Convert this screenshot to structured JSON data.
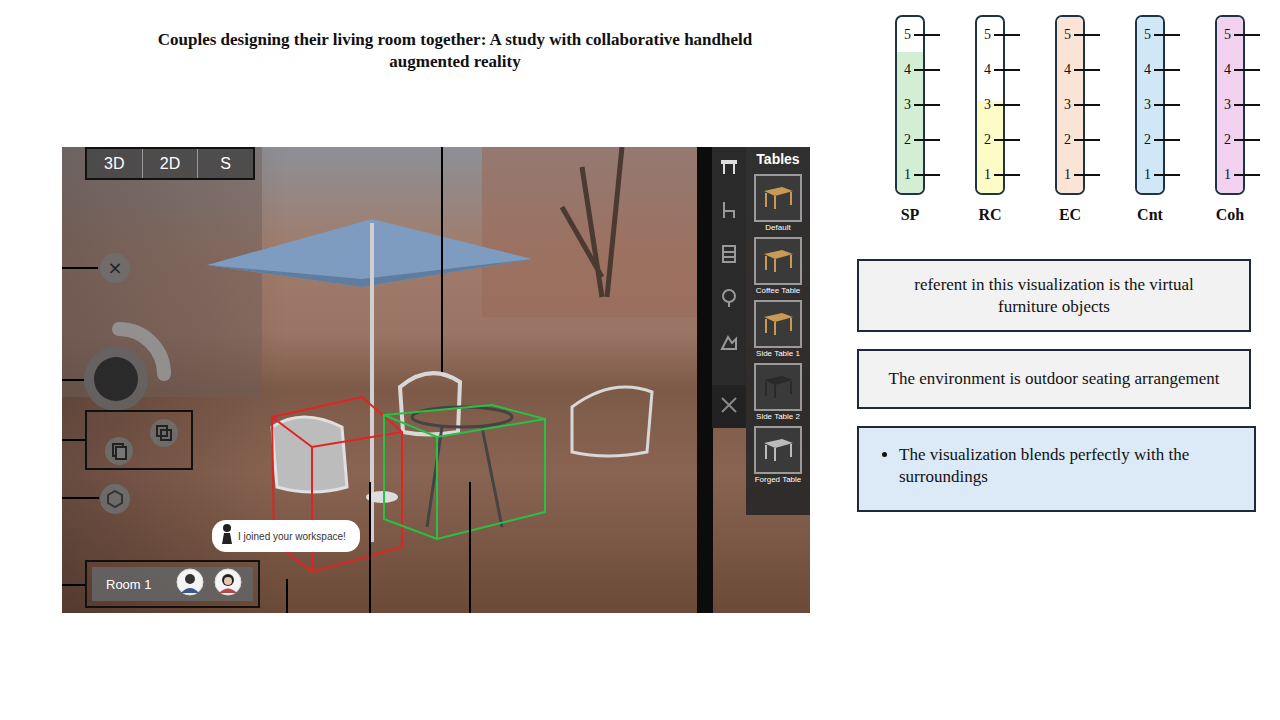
{
  "title": "Couples designing their living room together: A study with collaborative handheld augmented reality",
  "ar_app": {
    "view_modes": [
      {
        "label": "3D"
      },
      {
        "label": "2D"
      },
      {
        "label": "S"
      }
    ],
    "close_icon": "×",
    "catalog": {
      "title": "Tables",
      "items": [
        {
          "label": "Default"
        },
        {
          "label": "Coffee Table"
        },
        {
          "label": "Side Table 1"
        },
        {
          "label": "Side Table 2"
        },
        {
          "label": "Forged Table"
        }
      ]
    },
    "notification": "I joined your workspace!",
    "room": {
      "label": "Room 1"
    },
    "bounding_boxes": [
      {
        "color": "#e02424"
      },
      {
        "color": "#25c244"
      }
    ]
  },
  "scales": [
    {
      "label": "SP",
      "level": 0.8,
      "color": "#d3eed3",
      "ticks": [
        "5",
        "4",
        "3",
        "2",
        "1"
      ]
    },
    {
      "label": "RC",
      "level": 0.52,
      "color": "#fdfcc6",
      "ticks": [
        "5",
        "4",
        "3",
        "2",
        "1"
      ]
    },
    {
      "label": "EC",
      "level": 1,
      "color": "#fbe4d6",
      "ticks": [
        "5",
        "4",
        "3",
        "2",
        "1"
      ]
    },
    {
      "label": "Cnt",
      "level": 1,
      "color": "#cfe7f7",
      "ticks": [
        "5",
        "4",
        "3",
        "2",
        "1"
      ]
    },
    {
      "label": "Coh",
      "level": 1,
      "color": "#f1d1ef",
      "ticks": [
        "5",
        "4",
        "3",
        "2",
        "1"
      ]
    }
  ],
  "notes": [
    {
      "text": "referent in this visualization is the virtual furniture objects"
    },
    {
      "text": "The environment is outdoor seating arrangement"
    }
  ],
  "bullets": {
    "items": [
      "The visualization blends perfectly with the surroundings"
    ]
  }
}
